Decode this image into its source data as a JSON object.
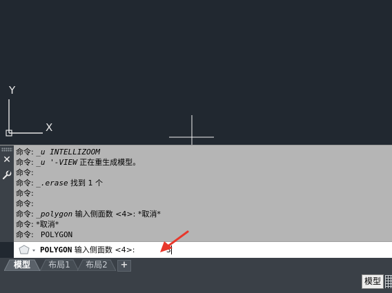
{
  "ucs": {
    "y_label": "Y",
    "x_label": "X"
  },
  "command_history": [
    {
      "prefix": "命令: ",
      "body": "_u INTELLIZOOM",
      "cn": ""
    },
    {
      "prefix": "命令: ",
      "body": "_u '-VIEW",
      "cn": " 正在重生成模型。"
    },
    {
      "prefix": "命令: ",
      "body": "",
      "cn": ""
    },
    {
      "prefix": "命令: ",
      "body": "_.erase",
      "cn": " 找到 1 个"
    },
    {
      "prefix": "命令: ",
      "body": "",
      "cn": ""
    },
    {
      "prefix": "命令: ",
      "body": "",
      "cn": ""
    },
    {
      "prefix": "命令: ",
      "body": "_polygon",
      "cn": " 输入侧面数 <4>: *取消*"
    },
    {
      "prefix": "命令: ",
      "body": "*取消*",
      "cn": ""
    },
    {
      "prefix": "命令: ",
      "body": " POLYGON",
      "cn": ""
    }
  ],
  "command_input": {
    "command": "POLYGON",
    "prompt": " 输入侧面数 <4>: ",
    "value": "3"
  },
  "tabs": [
    {
      "label": "模型",
      "active": true
    },
    {
      "label": "布局1",
      "active": false
    },
    {
      "label": "布局2",
      "active": false
    }
  ],
  "tab_add_label": "+",
  "status_bar": {
    "model_label": "模型"
  },
  "colors": {
    "canvas_bg": "#212830",
    "command_bg": "#b5b5b5",
    "arrow": "#e8372b"
  },
  "icons": {
    "close": "close-icon",
    "settings": "wrench-icon",
    "command_recent": "polygon-icon",
    "pointer": "red-arrow-icon",
    "grid": "grid-icon"
  }
}
